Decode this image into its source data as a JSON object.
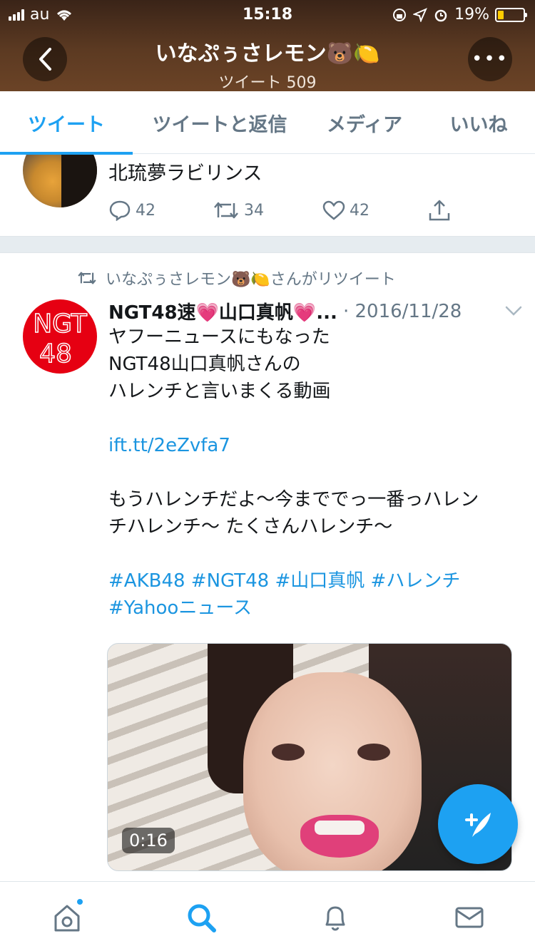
{
  "status_bar": {
    "carrier": "au",
    "time": "15:18",
    "battery": "19%"
  },
  "header": {
    "title": "いなぷぅさレモン🐻🍋",
    "subtitle": "ツイート 509",
    "more_label": "•••"
  },
  "tabs": [
    {
      "label": "ツイート",
      "active": true
    },
    {
      "label": "ツイートと返信",
      "active": false
    },
    {
      "label": "メディア",
      "active": false
    },
    {
      "label": "いいね",
      "active": false
    }
  ],
  "tweet1": {
    "text": "北琉夢ラビリンス",
    "replies": "42",
    "retweets": "34",
    "likes": "42"
  },
  "tweet2": {
    "retweeted_by": "いなぷぅさレモン🐻🍋さんがリツイート",
    "name": "NGT48速💗山口真帆💗...",
    "date": "· 2016/11/28",
    "avatar_text": "NGT48",
    "lines": [
      "ヤフーニュースにもなった",
      "NGT48山口真帆さんの",
      "ハレンチと言いまくる動画"
    ],
    "link": "ift.tt/2eZvfa7",
    "body2_line1": "もうハレンチだよ〜今まででっ一番っハレン",
    "body2_line2": "チハレンチ〜 たくさんハレンチ〜",
    "hashtags_line1": "#AKB48 #NGT48 #山口真帆 #ハレンチ",
    "hashtags_line2": "#Yahooニュース",
    "video_duration": "0:16"
  },
  "colors": {
    "accent": "#1da1f2",
    "link": "#1b95e0",
    "secondary_text": "#657786",
    "ngt_red": "#e60012"
  },
  "bottom_nav": [
    "home-icon",
    "search-icon",
    "notifications-icon",
    "messages-icon"
  ]
}
